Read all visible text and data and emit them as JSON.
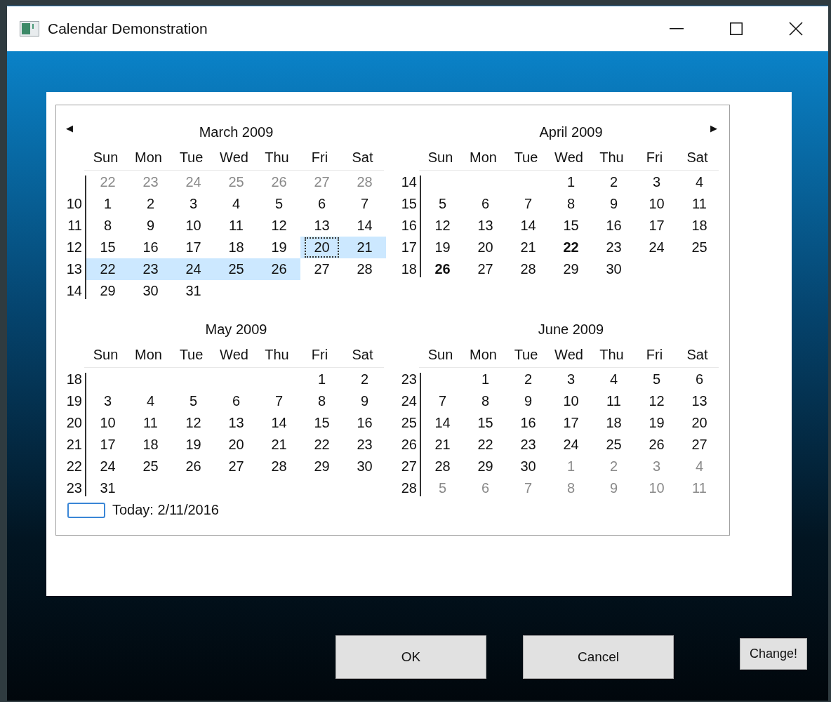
{
  "window": {
    "title": "Calendar Demonstration"
  },
  "calendar": {
    "prev_arrow": "◀",
    "next_arrow": "▶",
    "today": "Today: 2/11/2016",
    "months": [
      {
        "title": "March 2009",
        "weekdays": [
          "Sun",
          "Mon",
          "Tue",
          "Wed",
          "Thu",
          "Fri",
          "Sat"
        ],
        "weeks": [
          {
            "kind": "full",
            "days": [
              {
                "text": "22",
                "muted": true,
                "selected": false,
                "bold": false,
                "focused": false
              },
              {
                "text": "23",
                "muted": true,
                "selected": false,
                "bold": false,
                "focused": false
              },
              {
                "text": "24",
                "muted": true,
                "selected": false,
                "bold": false,
                "focused": false
              },
              {
                "text": "25",
                "muted": true,
                "selected": false,
                "bold": false,
                "focused": false
              },
              {
                "text": "26",
                "muted": true,
                "selected": false,
                "bold": false,
                "focused": false
              },
              {
                "text": "27",
                "muted": true,
                "selected": false,
                "bold": false,
                "focused": false
              },
              {
                "text": "28",
                "muted": true,
                "selected": false,
                "bold": false,
                "focused": false
              }
            ]
          },
          {
            "number": "10",
            "kind": "full",
            "days": [
              {
                "text": "1",
                "muted": false,
                "selected": false,
                "bold": false,
                "focused": false
              },
              {
                "text": "2",
                "muted": false,
                "selected": false,
                "bold": false,
                "focused": false
              },
              {
                "text": "3",
                "muted": false,
                "selected": false,
                "bold": false,
                "focused": false
              },
              {
                "text": "4",
                "muted": false,
                "selected": false,
                "bold": false,
                "focused": false
              },
              {
                "text": "5",
                "muted": false,
                "selected": false,
                "bold": false,
                "focused": false
              },
              {
                "text": "6",
                "muted": false,
                "selected": false,
                "bold": false,
                "focused": false
              },
              {
                "text": "7",
                "muted": false,
                "selected": false,
                "bold": false,
                "focused": false
              }
            ]
          },
          {
            "number": "11",
            "kind": "full",
            "days": [
              {
                "text": "8",
                "muted": false,
                "selected": false,
                "bold": false,
                "focused": false
              },
              {
                "text": "9",
                "muted": false,
                "selected": false,
                "bold": false,
                "focused": false
              },
              {
                "text": "10",
                "muted": false,
                "selected": false,
                "bold": false,
                "focused": false
              },
              {
                "text": "11",
                "muted": false,
                "selected": false,
                "bold": false,
                "focused": false
              },
              {
                "text": "12",
                "muted": false,
                "selected": false,
                "bold": false,
                "focused": false
              },
              {
                "text": "13",
                "muted": false,
                "selected": false,
                "bold": false,
                "focused": false
              },
              {
                "text": "14",
                "muted": false,
                "selected": false,
                "bold": false,
                "focused": false
              }
            ]
          },
          {
            "number": "12",
            "kind": "full",
            "days": [
              {
                "text": "15",
                "muted": false,
                "selected": false,
                "bold": false,
                "focused": false
              },
              {
                "text": "16",
                "muted": false,
                "selected": false,
                "bold": false,
                "focused": false
              },
              {
                "text": "17",
                "muted": false,
                "selected": false,
                "bold": false,
                "focused": false
              },
              {
                "text": "18",
                "muted": false,
                "selected": false,
                "bold": false,
                "focused": false
              },
              {
                "text": "19",
                "muted": false,
                "selected": false,
                "bold": false,
                "focused": false
              },
              {
                "text": "20",
                "muted": false,
                "selected": true,
                "bold": false,
                "focused": true
              },
              {
                "text": "21",
                "muted": false,
                "selected": true,
                "bold": false,
                "focused": false
              }
            ]
          },
          {
            "number": "13",
            "kind": "full",
            "days": [
              {
                "text": "22",
                "muted": false,
                "selected": true,
                "bold": false,
                "focused": false
              },
              {
                "text": "23",
                "muted": false,
                "selected": true,
                "bold": false,
                "focused": false
              },
              {
                "text": "24",
                "muted": false,
                "selected": true,
                "bold": false,
                "focused": false
              },
              {
                "text": "25",
                "muted": false,
                "selected": true,
                "bold": false,
                "focused": false
              },
              {
                "text": "26",
                "muted": false,
                "selected": true,
                "bold": false,
                "focused": false
              },
              {
                "text": "27",
                "muted": false,
                "selected": false,
                "bold": false,
                "focused": false
              },
              {
                "text": "28",
                "muted": false,
                "selected": false,
                "bold": false,
                "focused": false
              }
            ]
          },
          {
            "number": "14",
            "kind": "last",
            "days": [
              {
                "text": "29",
                "muted": false,
                "selected": false,
                "bold": false,
                "focused": false
              },
              {
                "text": "30",
                "muted": false,
                "selected": false,
                "bold": false,
                "focused": false
              },
              {
                "text": "31",
                "muted": false,
                "selected": false,
                "bold": false,
                "focused": false
              }
            ]
          }
        ]
      },
      {
        "title": "April 2009",
        "weekdays": [
          "Sun",
          "Mon",
          "Tue",
          "Wed",
          "Thu",
          "Fri",
          "Sat"
        ],
        "weeks": [
          {
            "number": "14",
            "kind": "first",
            "days": [
              {
                "text": "1",
                "muted": false,
                "selected": false,
                "bold": false,
                "focused": false
              },
              {
                "text": "2",
                "muted": false,
                "selected": false,
                "bold": false,
                "focused": false
              },
              {
                "text": "3",
                "muted": false,
                "selected": false,
                "bold": false,
                "focused": false
              },
              {
                "text": "4",
                "muted": false,
                "selected": false,
                "bold": false,
                "focused": false
              }
            ]
          },
          {
            "number": "15",
            "kind": "full",
            "days": [
              {
                "text": "5",
                "muted": false,
                "selected": false,
                "bold": false,
                "focused": false
              },
              {
                "text": "6",
                "muted": false,
                "selected": false,
                "bold": false,
                "focused": false
              },
              {
                "text": "7",
                "muted": false,
                "selected": false,
                "bold": false,
                "focused": false
              },
              {
                "text": "8",
                "muted": false,
                "selected": false,
                "bold": false,
                "focused": false
              },
              {
                "text": "9",
                "muted": false,
                "selected": false,
                "bold": false,
                "focused": false
              },
              {
                "text": "10",
                "muted": false,
                "selected": false,
                "bold": false,
                "focused": false
              },
              {
                "text": "11",
                "muted": false,
                "selected": false,
                "bold": false,
                "focused": false
              }
            ]
          },
          {
            "number": "16",
            "kind": "full",
            "days": [
              {
                "text": "12",
                "muted": false,
                "selected": false,
                "bold": false,
                "focused": false
              },
              {
                "text": "13",
                "muted": false,
                "selected": false,
                "bold": false,
                "focused": false
              },
              {
                "text": "14",
                "muted": false,
                "selected": false,
                "bold": false,
                "focused": false
              },
              {
                "text": "15",
                "muted": false,
                "selected": false,
                "bold": false,
                "focused": false
              },
              {
                "text": "16",
                "muted": false,
                "selected": false,
                "bold": false,
                "focused": false
              },
              {
                "text": "17",
                "muted": false,
                "selected": false,
                "bold": false,
                "focused": false
              },
              {
                "text": "18",
                "muted": false,
                "selected": false,
                "bold": false,
                "focused": false
              }
            ]
          },
          {
            "number": "17",
            "kind": "full",
            "days": [
              {
                "text": "19",
                "muted": false,
                "selected": false,
                "bold": false,
                "focused": false
              },
              {
                "text": "20",
                "muted": false,
                "selected": false,
                "bold": false,
                "focused": false
              },
              {
                "text": "21",
                "muted": false,
                "selected": false,
                "bold": false,
                "focused": false
              },
              {
                "text": "22",
                "muted": false,
                "selected": false,
                "bold": true,
                "focused": false
              },
              {
                "text": "23",
                "muted": false,
                "selected": false,
                "bold": false,
                "focused": false
              },
              {
                "text": "24",
                "muted": false,
                "selected": false,
                "bold": false,
                "focused": false
              },
              {
                "text": "25",
                "muted": false,
                "selected": false,
                "bold": false,
                "focused": false
              }
            ]
          },
          {
            "number": "18",
            "kind": "last",
            "days": [
              {
                "text": "26",
                "muted": false,
                "selected": false,
                "bold": true,
                "focused": false
              },
              {
                "text": "27",
                "muted": false,
                "selected": false,
                "bold": false,
                "focused": false
              },
              {
                "text": "28",
                "muted": false,
                "selected": false,
                "bold": false,
                "focused": false
              },
              {
                "text": "29",
                "muted": false,
                "selected": false,
                "bold": false,
                "focused": false
              },
              {
                "text": "30",
                "muted": false,
                "selected": false,
                "bold": false,
                "focused": false
              }
            ]
          }
        ]
      },
      {
        "title": "May 2009",
        "weekdays": [
          "Sun",
          "Mon",
          "Tue",
          "Wed",
          "Thu",
          "Fri",
          "Sat"
        ],
        "weeks": [
          {
            "number": "18",
            "kind": "first",
            "days": [
              {
                "text": "1",
                "muted": false,
                "selected": false,
                "bold": false,
                "focused": false
              },
              {
                "text": "2",
                "muted": false,
                "selected": false,
                "bold": false,
                "focused": false
              }
            ]
          },
          {
            "number": "19",
            "kind": "full",
            "days": [
              {
                "text": "3",
                "muted": false,
                "selected": false,
                "bold": false,
                "focused": false
              },
              {
                "text": "4",
                "muted": false,
                "selected": false,
                "bold": false,
                "focused": false
              },
              {
                "text": "5",
                "muted": false,
                "selected": false,
                "bold": false,
                "focused": false
              },
              {
                "text": "6",
                "muted": false,
                "selected": false,
                "bold": false,
                "focused": false
              },
              {
                "text": "7",
                "muted": false,
                "selected": false,
                "bold": false,
                "focused": false
              },
              {
                "text": "8",
                "muted": false,
                "selected": false,
                "bold": false,
                "focused": false
              },
              {
                "text": "9",
                "muted": false,
                "selected": false,
                "bold": false,
                "focused": false
              }
            ]
          },
          {
            "number": "20",
            "kind": "full",
            "days": [
              {
                "text": "10",
                "muted": false,
                "selected": false,
                "bold": false,
                "focused": false
              },
              {
                "text": "11",
                "muted": false,
                "selected": false,
                "bold": false,
                "focused": false
              },
              {
                "text": "12",
                "muted": false,
                "selected": false,
                "bold": false,
                "focused": false
              },
              {
                "text": "13",
                "muted": false,
                "selected": false,
                "bold": false,
                "focused": false
              },
              {
                "text": "14",
                "muted": false,
                "selected": false,
                "bold": false,
                "focused": false
              },
              {
                "text": "15",
                "muted": false,
                "selected": false,
                "bold": false,
                "focused": false
              },
              {
                "text": "16",
                "muted": false,
                "selected": false,
                "bold": false,
                "focused": false
              }
            ]
          },
          {
            "number": "21",
            "kind": "full",
            "days": [
              {
                "text": "17",
                "muted": false,
                "selected": false,
                "bold": false,
                "focused": false
              },
              {
                "text": "18",
                "muted": false,
                "selected": false,
                "bold": false,
                "focused": false
              },
              {
                "text": "19",
                "muted": false,
                "selected": false,
                "bold": false,
                "focused": false
              },
              {
                "text": "20",
                "muted": false,
                "selected": false,
                "bold": false,
                "focused": false
              },
              {
                "text": "21",
                "muted": false,
                "selected": false,
                "bold": false,
                "focused": false
              },
              {
                "text": "22",
                "muted": false,
                "selected": false,
                "bold": false,
                "focused": false
              },
              {
                "text": "23",
                "muted": false,
                "selected": false,
                "bold": false,
                "focused": false
              }
            ]
          },
          {
            "number": "22",
            "kind": "full",
            "days": [
              {
                "text": "24",
                "muted": false,
                "selected": false,
                "bold": false,
                "focused": false
              },
              {
                "text": "25",
                "muted": false,
                "selected": false,
                "bold": false,
                "focused": false
              },
              {
                "text": "26",
                "muted": false,
                "selected": false,
                "bold": false,
                "focused": false
              },
              {
                "text": "27",
                "muted": false,
                "selected": false,
                "bold": false,
                "focused": false
              },
              {
                "text": "28",
                "muted": false,
                "selected": false,
                "bold": false,
                "focused": false
              },
              {
                "text": "29",
                "muted": false,
                "selected": false,
                "bold": false,
                "focused": false
              },
              {
                "text": "30",
                "muted": false,
                "selected": false,
                "bold": false,
                "focused": false
              }
            ]
          },
          {
            "number": "23",
            "kind": "last",
            "days": [
              {
                "text": "31",
                "muted": false,
                "selected": false,
                "bold": false,
                "focused": false
              }
            ]
          }
        ]
      },
      {
        "title": "June 2009",
        "weekdays": [
          "Sun",
          "Mon",
          "Tue",
          "Wed",
          "Thu",
          "Fri",
          "Sat"
        ],
        "weeks": [
          {
            "number": "23",
            "kind": "first",
            "days": [
              {
                "text": "1",
                "muted": false,
                "selected": false,
                "bold": false,
                "focused": false
              },
              {
                "text": "2",
                "muted": false,
                "selected": false,
                "bold": false,
                "focused": false
              },
              {
                "text": "3",
                "muted": false,
                "selected": false,
                "bold": false,
                "focused": false
              },
              {
                "text": "4",
                "muted": false,
                "selected": false,
                "bold": false,
                "focused": false
              },
              {
                "text": "5",
                "muted": false,
                "selected": false,
                "bold": false,
                "focused": false
              },
              {
                "text": "6",
                "muted": false,
                "selected": false,
                "bold": false,
                "focused": false
              }
            ]
          },
          {
            "number": "24",
            "kind": "full",
            "days": [
              {
                "text": "7",
                "muted": false,
                "selected": false,
                "bold": false,
                "focused": false
              },
              {
                "text": "8",
                "muted": false,
                "selected": false,
                "bold": false,
                "focused": false
              },
              {
                "text": "9",
                "muted": false,
                "selected": false,
                "bold": false,
                "focused": false
              },
              {
                "text": "10",
                "muted": false,
                "selected": false,
                "bold": false,
                "focused": false
              },
              {
                "text": "11",
                "muted": false,
                "selected": false,
                "bold": false,
                "focused": false
              },
              {
                "text": "12",
                "muted": false,
                "selected": false,
                "bold": false,
                "focused": false
              },
              {
                "text": "13",
                "muted": false,
                "selected": false,
                "bold": false,
                "focused": false
              }
            ]
          },
          {
            "number": "25",
            "kind": "full",
            "days": [
              {
                "text": "14",
                "muted": false,
                "selected": false,
                "bold": false,
                "focused": false
              },
              {
                "text": "15",
                "muted": false,
                "selected": false,
                "bold": false,
                "focused": false
              },
              {
                "text": "16",
                "muted": false,
                "selected": false,
                "bold": false,
                "focused": false
              },
              {
                "text": "17",
                "muted": false,
                "selected": false,
                "bold": false,
                "focused": false
              },
              {
                "text": "18",
                "muted": false,
                "selected": false,
                "bold": false,
                "focused": false
              },
              {
                "text": "19",
                "muted": false,
                "selected": false,
                "bold": false,
                "focused": false
              },
              {
                "text": "20",
                "muted": false,
                "selected": false,
                "bold": false,
                "focused": false
              }
            ]
          },
          {
            "number": "26",
            "kind": "full",
            "days": [
              {
                "text": "21",
                "muted": false,
                "selected": false,
                "bold": false,
                "focused": false
              },
              {
                "text": "22",
                "muted": false,
                "selected": false,
                "bold": false,
                "focused": false
              },
              {
                "text": "23",
                "muted": false,
                "selected": false,
                "bold": false,
                "focused": false
              },
              {
                "text": "24",
                "muted": false,
                "selected": false,
                "bold": false,
                "focused": false
              },
              {
                "text": "25",
                "muted": false,
                "selected": false,
                "bold": false,
                "focused": false
              },
              {
                "text": "26",
                "muted": false,
                "selected": false,
                "bold": false,
                "focused": false
              },
              {
                "text": "27",
                "muted": false,
                "selected": false,
                "bold": false,
                "focused": false
              }
            ]
          },
          {
            "number": "27",
            "kind": "full",
            "days": [
              {
                "text": "28",
                "muted": false,
                "selected": false,
                "bold": false,
                "focused": false
              },
              {
                "text": "29",
                "muted": false,
                "selected": false,
                "bold": false,
                "focused": false
              },
              {
                "text": "30",
                "muted": false,
                "selected": false,
                "bold": false,
                "focused": false
              },
              {
                "text": "1",
                "muted": true,
                "selected": false,
                "bold": false,
                "focused": false
              },
              {
                "text": "2",
                "muted": true,
                "selected": false,
                "bold": false,
                "focused": false
              },
              {
                "text": "3",
                "muted": true,
                "selected": false,
                "bold": false,
                "focused": false
              },
              {
                "text": "4",
                "muted": true,
                "selected": false,
                "bold": false,
                "focused": false
              }
            ]
          },
          {
            "number": "28",
            "kind": "full",
            "days": [
              {
                "text": "5",
                "muted": true,
                "selected": false,
                "bold": false,
                "focused": false
              },
              {
                "text": "6",
                "muted": true,
                "selected": false,
                "bold": false,
                "focused": false
              },
              {
                "text": "7",
                "muted": true,
                "selected": false,
                "bold": false,
                "focused": false
              },
              {
                "text": "8",
                "muted": true,
                "selected": false,
                "bold": false,
                "focused": false
              },
              {
                "text": "9",
                "muted": true,
                "selected": false,
                "bold": false,
                "focused": false
              },
              {
                "text": "10",
                "muted": true,
                "selected": false,
                "bold": false,
                "focused": false
              },
              {
                "text": "11",
                "muted": true,
                "selected": false,
                "bold": false,
                "focused": false
              }
            ]
          }
        ]
      }
    ]
  },
  "buttons": [
    {
      "label": "OK",
      "kind": "dialog"
    },
    {
      "label": "Cancel",
      "kind": "dialog"
    },
    {
      "label": "Change!",
      "kind": "small"
    }
  ]
}
